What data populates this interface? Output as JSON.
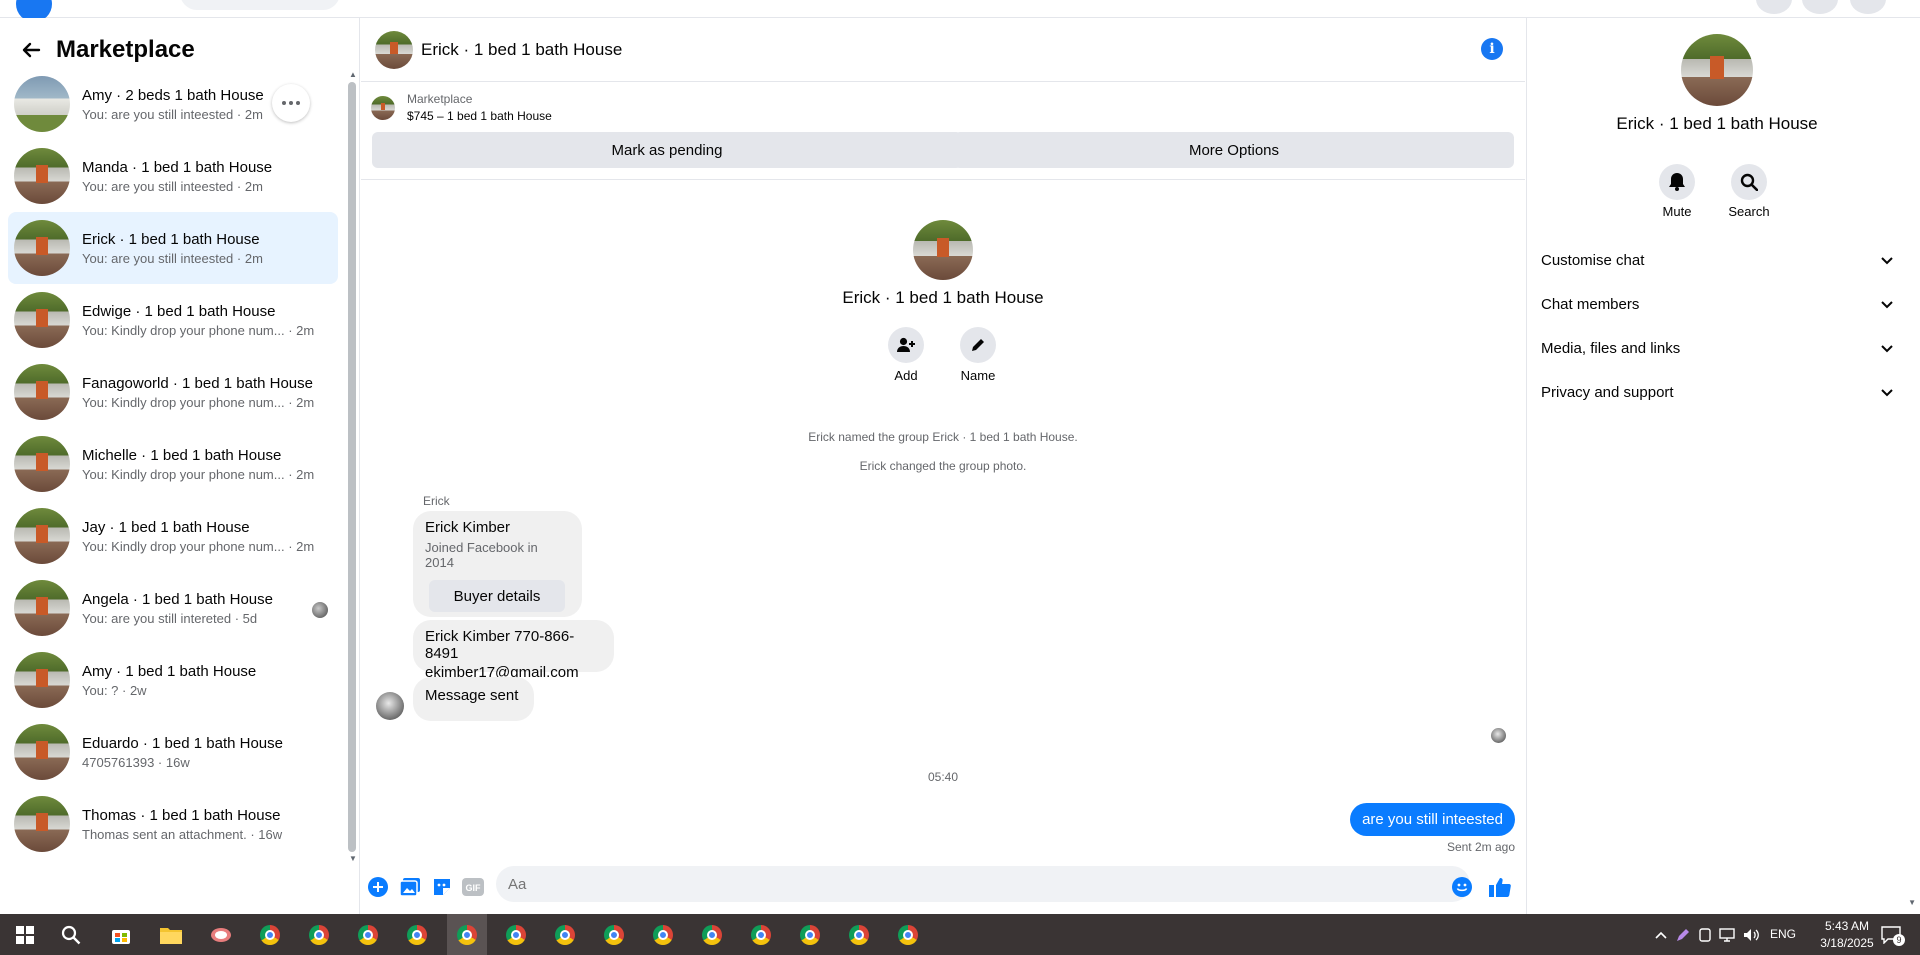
{
  "sidebar": {
    "title": "Marketplace",
    "conversations": [
      {
        "name": "Amy · 2 beds 1 bath House",
        "sub": "You: are you still inteested · 2m"
      },
      {
        "name": "Manda · 1 bed 1 bath House",
        "sub": "You: are you still inteested · 2m"
      },
      {
        "name": "Erick · 1 bed 1 bath House",
        "sub": "You: are you still inteested · 2m"
      },
      {
        "name": "Edwige · 1 bed 1 bath House",
        "sub": "You: Kindly drop your phone num... · 2m"
      },
      {
        "name": "Fanagoworld · 1 bed 1 bath House",
        "sub": "You: Kindly drop your phone num... · 2m"
      },
      {
        "name": "Michelle · 1 bed 1 bath House",
        "sub": "You: Kindly drop your phone num... · 2m"
      },
      {
        "name": "Jay · 1 bed 1 bath House",
        "sub": "You: Kindly drop your phone num... · 2m"
      },
      {
        "name": "Angela · 1 bed 1 bath House",
        "sub": "You: are you still intereted · 5d"
      },
      {
        "name": "Amy · 1 bed 1 bath House",
        "sub": "You: ? · 2w"
      },
      {
        "name": "Eduardo · 1 bed 1 bath House",
        "sub": "4705761393 · 16w"
      },
      {
        "name": "Thomas · 1 bed 1 bath House",
        "sub": "Thomas sent an attachment. · 16w"
      }
    ]
  },
  "chat": {
    "title": "Erick · 1 bed 1 bath House",
    "marketplace_label": "Marketplace",
    "listing": "$745 – 1 bed 1 bath House",
    "mark_pending_label": "Mark as pending",
    "more_options_label": "More Options",
    "center_title": "Erick · 1 bed 1 bath House",
    "add_label": "Add",
    "name_label": "Name",
    "sys_msg_1": "Erick named the group Erick · 1 bed 1 bath House.",
    "sys_msg_2": "Erick changed the group photo.",
    "sender": "Erick",
    "card_name": "Erick Kimber",
    "card_sub": "Joined Facebook in 2014",
    "buyer_details_label": "Buyer details",
    "contact_line1": "Erick Kimber 770-866-8491",
    "contact_line2": "ekimber17@gmail.com",
    "message_sent": "Message sent",
    "timestamp": "05:40",
    "my_message": "are you still inteested",
    "sent_status": "Sent 2m ago",
    "input_placeholder": "Aa"
  },
  "right_panel": {
    "title": "Erick · 1 bed 1 bath House",
    "mute_label": "Mute",
    "search_label": "Search",
    "sections": [
      "Customise chat",
      "Chat members",
      "Media, files and links",
      "Privacy and support"
    ]
  },
  "taskbar": {
    "lang": "ENG",
    "time": "5:43 AM",
    "date": "3/18/2025",
    "notif_count": "9"
  },
  "colors": {
    "accent": "#0a7cff",
    "active_row": "#e7f3ff",
    "taskbar": "#3a3434"
  }
}
